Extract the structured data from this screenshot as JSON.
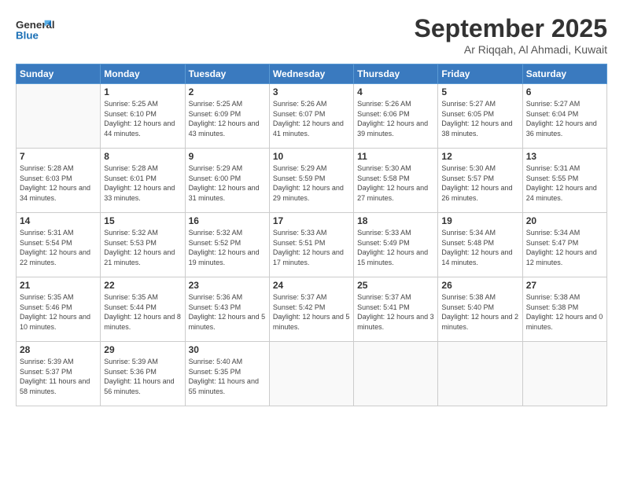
{
  "header": {
    "logo_line1": "General",
    "logo_line2": "Blue",
    "month_title": "September 2025",
    "location": "Ar Riqqah, Al Ahmadi, Kuwait"
  },
  "weekdays": [
    "Sunday",
    "Monday",
    "Tuesday",
    "Wednesday",
    "Thursday",
    "Friday",
    "Saturday"
  ],
  "weeks": [
    [
      {
        "day": "",
        "sunrise": "",
        "sunset": "",
        "daylight": ""
      },
      {
        "day": "1",
        "sunrise": "Sunrise: 5:25 AM",
        "sunset": "Sunset: 6:10 PM",
        "daylight": "Daylight: 12 hours and 44 minutes."
      },
      {
        "day": "2",
        "sunrise": "Sunrise: 5:25 AM",
        "sunset": "Sunset: 6:09 PM",
        "daylight": "Daylight: 12 hours and 43 minutes."
      },
      {
        "day": "3",
        "sunrise": "Sunrise: 5:26 AM",
        "sunset": "Sunset: 6:07 PM",
        "daylight": "Daylight: 12 hours and 41 minutes."
      },
      {
        "day": "4",
        "sunrise": "Sunrise: 5:26 AM",
        "sunset": "Sunset: 6:06 PM",
        "daylight": "Daylight: 12 hours and 39 minutes."
      },
      {
        "day": "5",
        "sunrise": "Sunrise: 5:27 AM",
        "sunset": "Sunset: 6:05 PM",
        "daylight": "Daylight: 12 hours and 38 minutes."
      },
      {
        "day": "6",
        "sunrise": "Sunrise: 5:27 AM",
        "sunset": "Sunset: 6:04 PM",
        "daylight": "Daylight: 12 hours and 36 minutes."
      }
    ],
    [
      {
        "day": "7",
        "sunrise": "Sunrise: 5:28 AM",
        "sunset": "Sunset: 6:03 PM",
        "daylight": "Daylight: 12 hours and 34 minutes."
      },
      {
        "day": "8",
        "sunrise": "Sunrise: 5:28 AM",
        "sunset": "Sunset: 6:01 PM",
        "daylight": "Daylight: 12 hours and 33 minutes."
      },
      {
        "day": "9",
        "sunrise": "Sunrise: 5:29 AM",
        "sunset": "Sunset: 6:00 PM",
        "daylight": "Daylight: 12 hours and 31 minutes."
      },
      {
        "day": "10",
        "sunrise": "Sunrise: 5:29 AM",
        "sunset": "Sunset: 5:59 PM",
        "daylight": "Daylight: 12 hours and 29 minutes."
      },
      {
        "day": "11",
        "sunrise": "Sunrise: 5:30 AM",
        "sunset": "Sunset: 5:58 PM",
        "daylight": "Daylight: 12 hours and 27 minutes."
      },
      {
        "day": "12",
        "sunrise": "Sunrise: 5:30 AM",
        "sunset": "Sunset: 5:57 PM",
        "daylight": "Daylight: 12 hours and 26 minutes."
      },
      {
        "day": "13",
        "sunrise": "Sunrise: 5:31 AM",
        "sunset": "Sunset: 5:55 PM",
        "daylight": "Daylight: 12 hours and 24 minutes."
      }
    ],
    [
      {
        "day": "14",
        "sunrise": "Sunrise: 5:31 AM",
        "sunset": "Sunset: 5:54 PM",
        "daylight": "Daylight: 12 hours and 22 minutes."
      },
      {
        "day": "15",
        "sunrise": "Sunrise: 5:32 AM",
        "sunset": "Sunset: 5:53 PM",
        "daylight": "Daylight: 12 hours and 21 minutes."
      },
      {
        "day": "16",
        "sunrise": "Sunrise: 5:32 AM",
        "sunset": "Sunset: 5:52 PM",
        "daylight": "Daylight: 12 hours and 19 minutes."
      },
      {
        "day": "17",
        "sunrise": "Sunrise: 5:33 AM",
        "sunset": "Sunset: 5:51 PM",
        "daylight": "Daylight: 12 hours and 17 minutes."
      },
      {
        "day": "18",
        "sunrise": "Sunrise: 5:33 AM",
        "sunset": "Sunset: 5:49 PM",
        "daylight": "Daylight: 12 hours and 15 minutes."
      },
      {
        "day": "19",
        "sunrise": "Sunrise: 5:34 AM",
        "sunset": "Sunset: 5:48 PM",
        "daylight": "Daylight: 12 hours and 14 minutes."
      },
      {
        "day": "20",
        "sunrise": "Sunrise: 5:34 AM",
        "sunset": "Sunset: 5:47 PM",
        "daylight": "Daylight: 12 hours and 12 minutes."
      }
    ],
    [
      {
        "day": "21",
        "sunrise": "Sunrise: 5:35 AM",
        "sunset": "Sunset: 5:46 PM",
        "daylight": "Daylight: 12 hours and 10 minutes."
      },
      {
        "day": "22",
        "sunrise": "Sunrise: 5:35 AM",
        "sunset": "Sunset: 5:44 PM",
        "daylight": "Daylight: 12 hours and 8 minutes."
      },
      {
        "day": "23",
        "sunrise": "Sunrise: 5:36 AM",
        "sunset": "Sunset: 5:43 PM",
        "daylight": "Daylight: 12 hours and 5 minutes."
      },
      {
        "day": "24",
        "sunrise": "Sunrise: 5:37 AM",
        "sunset": "Sunset: 5:42 PM",
        "daylight": "Daylight: 12 hours and 5 minutes."
      },
      {
        "day": "25",
        "sunrise": "Sunrise: 5:37 AM",
        "sunset": "Sunset: 5:41 PM",
        "daylight": "Daylight: 12 hours and 3 minutes."
      },
      {
        "day": "26",
        "sunrise": "Sunrise: 5:38 AM",
        "sunset": "Sunset: 5:40 PM",
        "daylight": "Daylight: 12 hours and 2 minutes."
      },
      {
        "day": "27",
        "sunrise": "Sunrise: 5:38 AM",
        "sunset": "Sunset: 5:38 PM",
        "daylight": "Daylight: 12 hours and 0 minutes."
      }
    ],
    [
      {
        "day": "28",
        "sunrise": "Sunrise: 5:39 AM",
        "sunset": "Sunset: 5:37 PM",
        "daylight": "Daylight: 11 hours and 58 minutes."
      },
      {
        "day": "29",
        "sunrise": "Sunrise: 5:39 AM",
        "sunset": "Sunset: 5:36 PM",
        "daylight": "Daylight: 11 hours and 56 minutes."
      },
      {
        "day": "30",
        "sunrise": "Sunrise: 5:40 AM",
        "sunset": "Sunset: 5:35 PM",
        "daylight": "Daylight: 11 hours and 55 minutes."
      },
      {
        "day": "",
        "sunrise": "",
        "sunset": "",
        "daylight": ""
      },
      {
        "day": "",
        "sunrise": "",
        "sunset": "",
        "daylight": ""
      },
      {
        "day": "",
        "sunrise": "",
        "sunset": "",
        "daylight": ""
      },
      {
        "day": "",
        "sunrise": "",
        "sunset": "",
        "daylight": ""
      }
    ]
  ]
}
